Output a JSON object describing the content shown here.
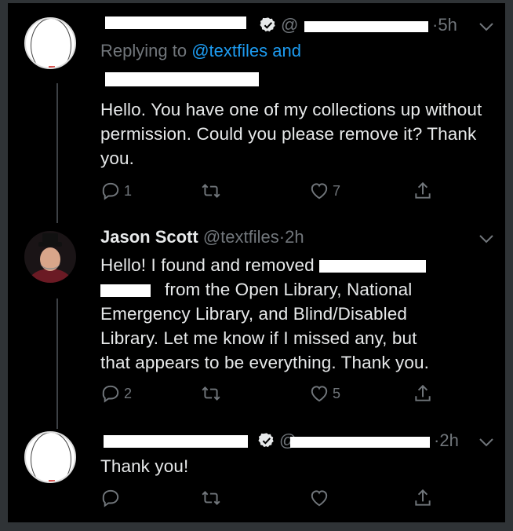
{
  "tweets": [
    {
      "handle_prefix": "@",
      "time": "5h",
      "replying_label": "Replying to",
      "replying_handle": "@textfiles and",
      "text": "Hello. You have one of my collections up without permission. Could you please remove it? Thank you.",
      "replies": "1",
      "retweets": "",
      "likes": "7"
    },
    {
      "name": "Jason Scott",
      "handle": "@textfiles",
      "time": "2h",
      "text_line1": "Hello! I found and removed",
      "text_line2": "from the Open Library, National",
      "text_line3": "Emergency Library, and Blind/Disabled",
      "text_line4": "Library. Let me know if I missed any, but",
      "text_line5": "that appears to be everything. Thank you.",
      "replies": "2",
      "retweets": "",
      "likes": "5"
    },
    {
      "handle_prefix": "@",
      "time": "2h",
      "text": "Thank you!",
      "replies": "",
      "retweets": "",
      "likes": ""
    }
  ],
  "separator": "·",
  "colors": {
    "background": "#000000",
    "text": "#e7e9ea",
    "muted": "#71767b",
    "link": "#1d9bf0"
  },
  "icons": [
    "reply-icon",
    "retweet-icon",
    "like-icon",
    "share-icon",
    "verified-icon",
    "chevron-down-icon"
  ]
}
